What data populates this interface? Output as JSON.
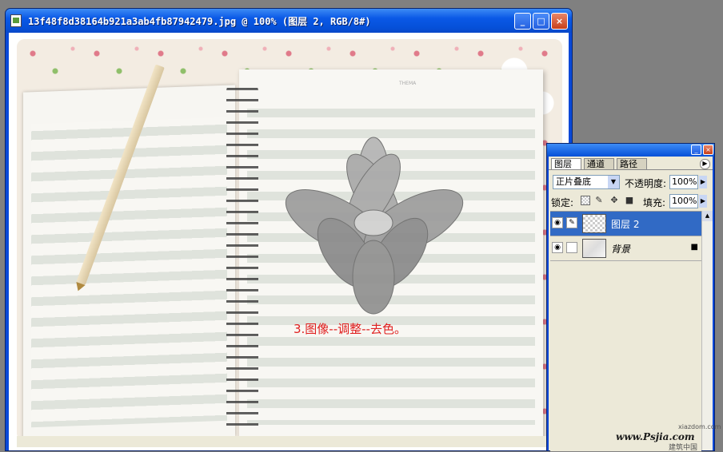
{
  "window": {
    "title": "13f48f8d38164b921a3ab4fb87942479.jpg @ 100% (图层 2, RGB/8#)",
    "minimize_glyph": "_",
    "maximize_glyph": "□",
    "close_glyph": "×"
  },
  "canvas": {
    "caption": "3.图像--调整--去色。",
    "caption_color": "#e02020",
    "notebook_header": "THEMA"
  },
  "layers_panel": {
    "tabs": [
      "图层",
      "通道",
      "路径"
    ],
    "blend_mode": "正片叠底",
    "opacity_label": "不透明度:",
    "opacity_value": "100%",
    "lock_label": "锁定:",
    "fill_label": "填充:",
    "fill_value": "100%",
    "layers": [
      {
        "name": "图层 2",
        "selected": true
      },
      {
        "name": "背景",
        "selected": false
      }
    ],
    "selected_color": "#316ac5",
    "icons": [
      "eye-icon",
      "brush-icon",
      "lock-transparent-icon",
      "lock-paint-icon",
      "move-icon",
      "lock-icon",
      "panel-menu-icon"
    ]
  },
  "watermark": {
    "url": "www.Psjia.com",
    "small": "xiazdom.com",
    "cn": "建筑中国"
  }
}
